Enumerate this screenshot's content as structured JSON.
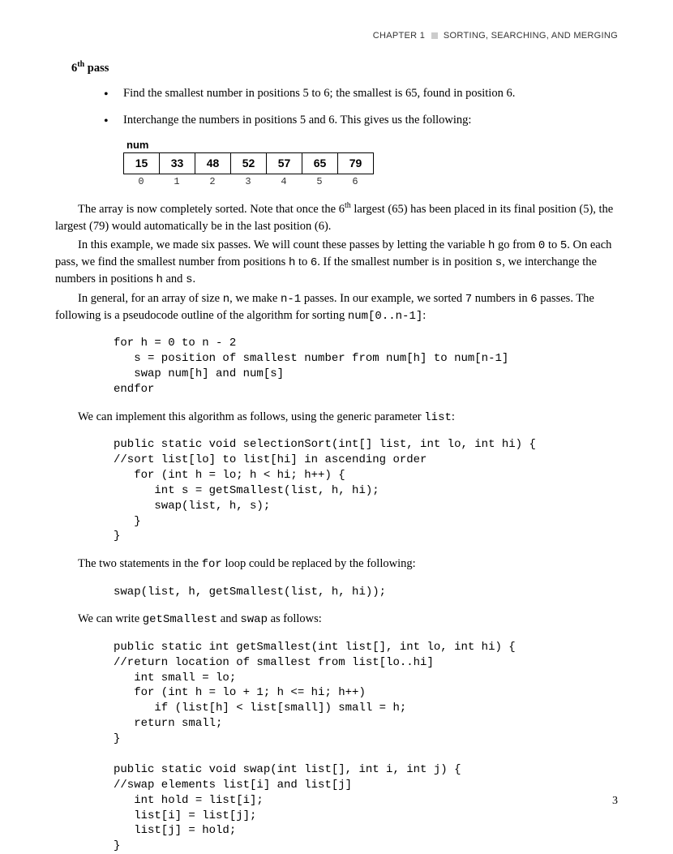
{
  "header": {
    "chapter": "CHAPTER 1",
    "title": "SORTING, SEARCHING, AND MERGING"
  },
  "section_title_pre": "6",
  "section_title_sup": "th",
  "section_title_post": " pass",
  "bullets": [
    "Find the smallest number in positions 5 to 6; the smallest is 65, found in position 6.",
    "Interchange the numbers in positions 5 and 6. This gives us the following:"
  ],
  "table": {
    "label": "num",
    "cells": [
      "15",
      "33",
      "48",
      "52",
      "57",
      "65",
      "79"
    ],
    "indices": [
      "0",
      "1",
      "2",
      "3",
      "4",
      "5",
      "6"
    ]
  },
  "para1a": "The array is now completely sorted. Note that once the 6",
  "para1sup": "th",
  "para1b": " largest (65) has been placed in its final position (5), the largest (79) would automatically be in the last position (6).",
  "para2a": "In this example, we made six passes. We will count these passes by letting the variable ",
  "para2_h": "h",
  "para2b": " go from ",
  "para2_0": "0",
  "para2c": " to ",
  "para2_5": "5",
  "para2d": ". On each pass, we find the smallest number from positions ",
  "para2_h2": "h",
  "para2e": " to ",
  "para2_6": "6",
  "para2f": ". If the smallest number is in position ",
  "para2_s": "s",
  "para2g": ", we interchange the numbers in positions ",
  "para2_h3": "h",
  "para2h": " and ",
  "para2_s2": "s",
  "para2i": ".",
  "para3a": "In general, for an array of size ",
  "para3_n": "n",
  "para3b": ", we make ",
  "para3_n1": "n-1",
  "para3c": " passes. In our example, we sorted ",
  "para3_7": "7",
  "para3d": " numbers in ",
  "para3_6": "6",
  "para3e": " passes. The following is a pseudocode outline of the algorithm for sorting ",
  "para3_num": "num[0..n-1]",
  "para3f": ":",
  "code1": "for h = 0 to n - 2\n   s = position of smallest number from num[h] to num[n-1]\n   swap num[h] and num[s]\nendfor",
  "lead1a": "We can implement this algorithm as follows, using the generic parameter ",
  "lead1_list": "list",
  "lead1b": ":",
  "code2": "public static void selectionSort(int[] list, int lo, int hi) {\n//sort list[lo] to list[hi] in ascending order\n   for (int h = lo; h < hi; h++) {\n      int s = getSmallest(list, h, hi);\n      swap(list, h, s);\n   }\n}",
  "lead2a": "The two statements in the ",
  "lead2_for": "for",
  "lead2b": " loop could be replaced by the following:",
  "code3": "swap(list, h, getSmallest(list, h, hi));",
  "lead3a": "We can write ",
  "lead3_gs": "getSmallest",
  "lead3b": " and ",
  "lead3_sw": "swap",
  "lead3c": " as follows:",
  "code4": "public static int getSmallest(int list[], int lo, int hi) {\n//return location of smallest from list[lo..hi]\n   int small = lo;\n   for (int h = lo + 1; h <= hi; h++)\n      if (list[h] < list[small]) small = h;\n   return small;\n}\n\npublic static void swap(int list[], int i, int j) {\n//swap elements list[i] and list[j]\n   int hold = list[i];\n   list[i] = list[j];\n   list[j] = hold;\n}",
  "page_number": "3"
}
